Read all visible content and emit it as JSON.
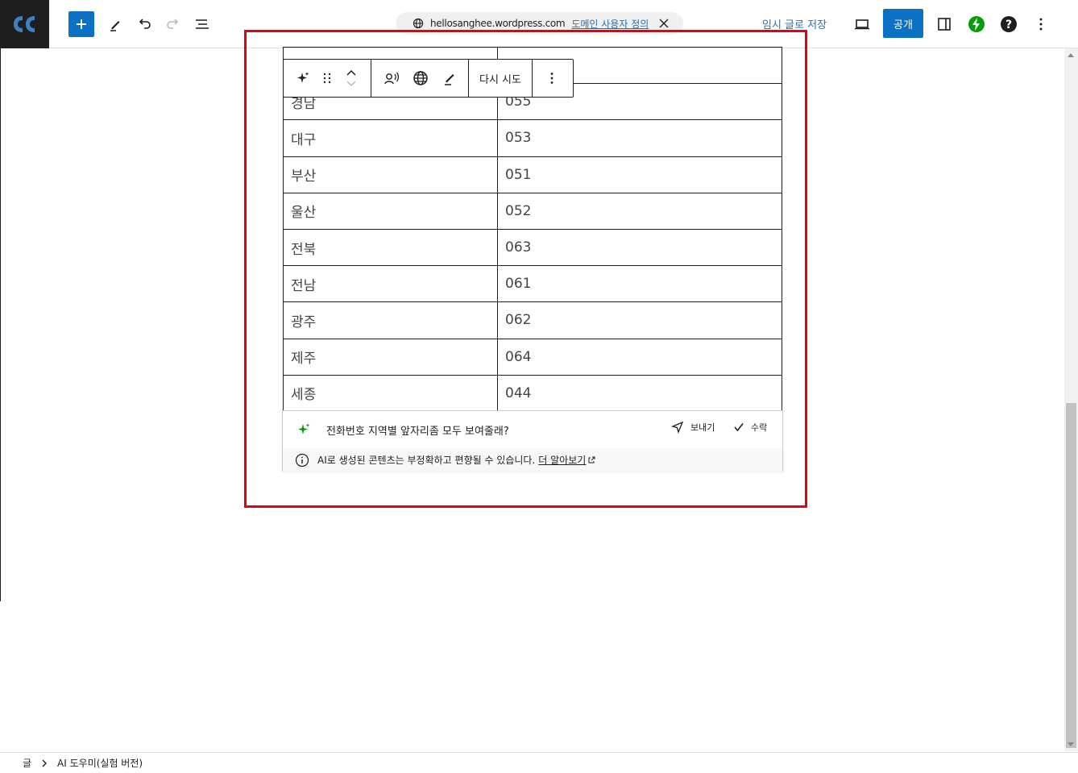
{
  "topbar": {
    "url_domain": "hellosanghee.wordpress.com",
    "url_custom_link": "도메인 사용자 정의",
    "save_draft": "임시 글로 저장",
    "publish": "공개"
  },
  "block_toolbar": {
    "retry": "다시 시도"
  },
  "table": {
    "rows": [
      [
        "",
        ""
      ],
      [
        "경남",
        "055"
      ],
      [
        "대구",
        "053"
      ],
      [
        "부산",
        "051"
      ],
      [
        "울산",
        "052"
      ],
      [
        "전북",
        "063"
      ],
      [
        "전남",
        "061"
      ],
      [
        "광주",
        "062"
      ],
      [
        "제주",
        "064"
      ],
      [
        "세종",
        "044"
      ]
    ]
  },
  "ai_assistant": {
    "prompt": "전화번호 지역별 앞자리좀 모두 보여줄래?",
    "send_label": "보내기",
    "accept_label": "수락",
    "disclaimer": "AI로 생성된 콘텐츠는 부정확하고 편향될 수 있습니다.",
    "learn_more": "더 알아보기"
  },
  "breadcrumb": {
    "root": "글",
    "current": "AI 도우미(실험 버전)"
  },
  "colors": {
    "accent": "#0a71c4",
    "highlight_box": "#e60012",
    "jetpack": "#069e08",
    "ai_sparkle": "#069e08"
  }
}
